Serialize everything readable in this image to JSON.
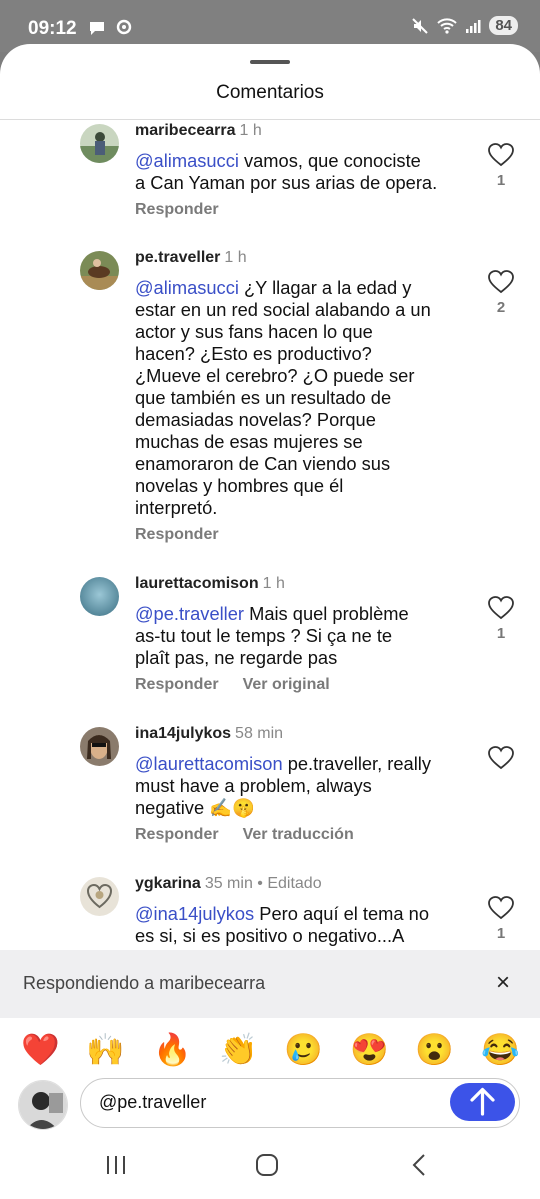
{
  "status_bar": {
    "time": "09:12",
    "battery": "84"
  },
  "sheet": {
    "title": "Comentarios"
  },
  "comments": [
    {
      "username": "maribecearra",
      "time": "1 h",
      "mention": "@alimasucci",
      "text_lines": [
        "vamos, que conociste",
        "a Can Yaman por sus arias de opera."
      ],
      "likes": "1",
      "actions": [
        "Responder"
      ]
    },
    {
      "username": "pe.traveller",
      "time": "1 h",
      "mention": "@alimasucci",
      "text_lines": [
        "¿Y llagar a la edad y",
        "estar en un red social alabando a un",
        "actor y sus fans hacen lo que",
        "hacen? ¿Esto es productivo?",
        "¿Mueve el cerebro? ¿O puede ser",
        "que también es un resultado de",
        "demasiadas novelas? Porque",
        "muchas de esas mujeres se",
        "enamoraron de Can viendo sus",
        "novelas y hombres que él",
        "interpretó."
      ],
      "likes": "2",
      "actions": [
        "Responder"
      ]
    },
    {
      "username": "laurettacomison",
      "time": "1 h",
      "mention": "@pe.traveller",
      "text_lines": [
        "Mais quel problème",
        "as-tu tout le temps ? Si ça ne te",
        "plaît pas, ne regarde pas"
      ],
      "likes": "1",
      "actions": [
        "Responder",
        "Ver original"
      ]
    },
    {
      "username": "ina14julykos",
      "time": "58 min",
      "mention": "@laurettacomison",
      "text_lines": [
        "pe.traveller, really",
        "must have a problem, always",
        "negative ✍️🤫"
      ],
      "likes": "",
      "actions": [
        "Responder",
        "Ver traducción"
      ]
    },
    {
      "username": "ygkarina",
      "time": "35 min • Editado",
      "mention": "@ina14julykos",
      "text_lines": [
        "Pero aquí el tema no",
        "es si, si es positivo o negativo...A"
      ],
      "likes": "1",
      "actions": []
    }
  ],
  "reply_bar": {
    "text": "Respondiendo a maribecearra",
    "close_icon": "×"
  },
  "emojis": [
    "❤️",
    "🙌",
    "🔥",
    "👏",
    "🥲",
    "😍",
    "😮",
    "😂"
  ],
  "input": {
    "value": "@pe.traveller"
  }
}
